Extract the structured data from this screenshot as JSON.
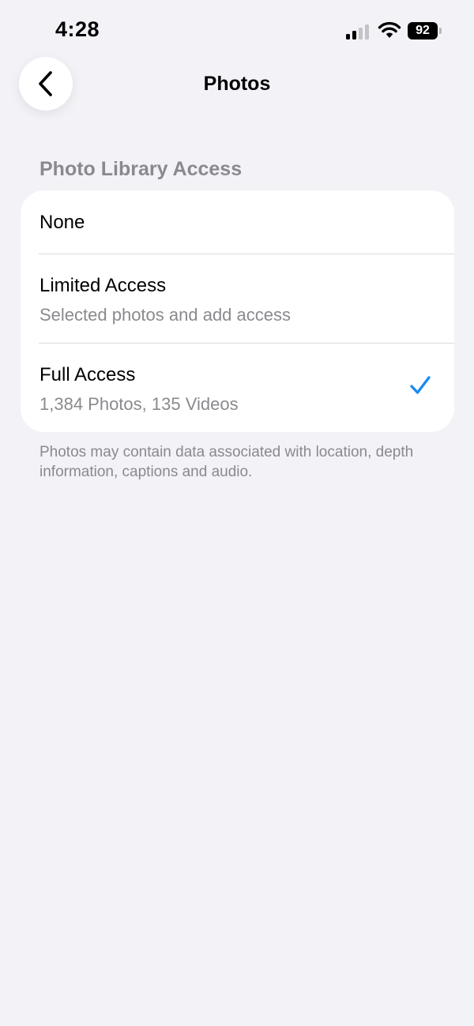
{
  "status_bar": {
    "time": "4:28",
    "battery_level": "92",
    "signal_bars_active": 2,
    "signal_bars_total": 4
  },
  "nav": {
    "title": "Photos"
  },
  "section": {
    "header": "Photo Library Access",
    "options": [
      {
        "title": "None",
        "subtitle": "",
        "selected": false
      },
      {
        "title": "Limited Access",
        "subtitle": "Selected photos and add access",
        "selected": false
      },
      {
        "title": "Full Access",
        "subtitle": "1,384 Photos, 135 Videos",
        "selected": true
      }
    ],
    "footnote": "Photos may contain data associated with location, depth information, captions and audio."
  },
  "colors": {
    "background": "#f2f2f7",
    "card": "#ffffff",
    "accent": "#1a8cf0",
    "secondary_text": "#8a8a8e"
  }
}
